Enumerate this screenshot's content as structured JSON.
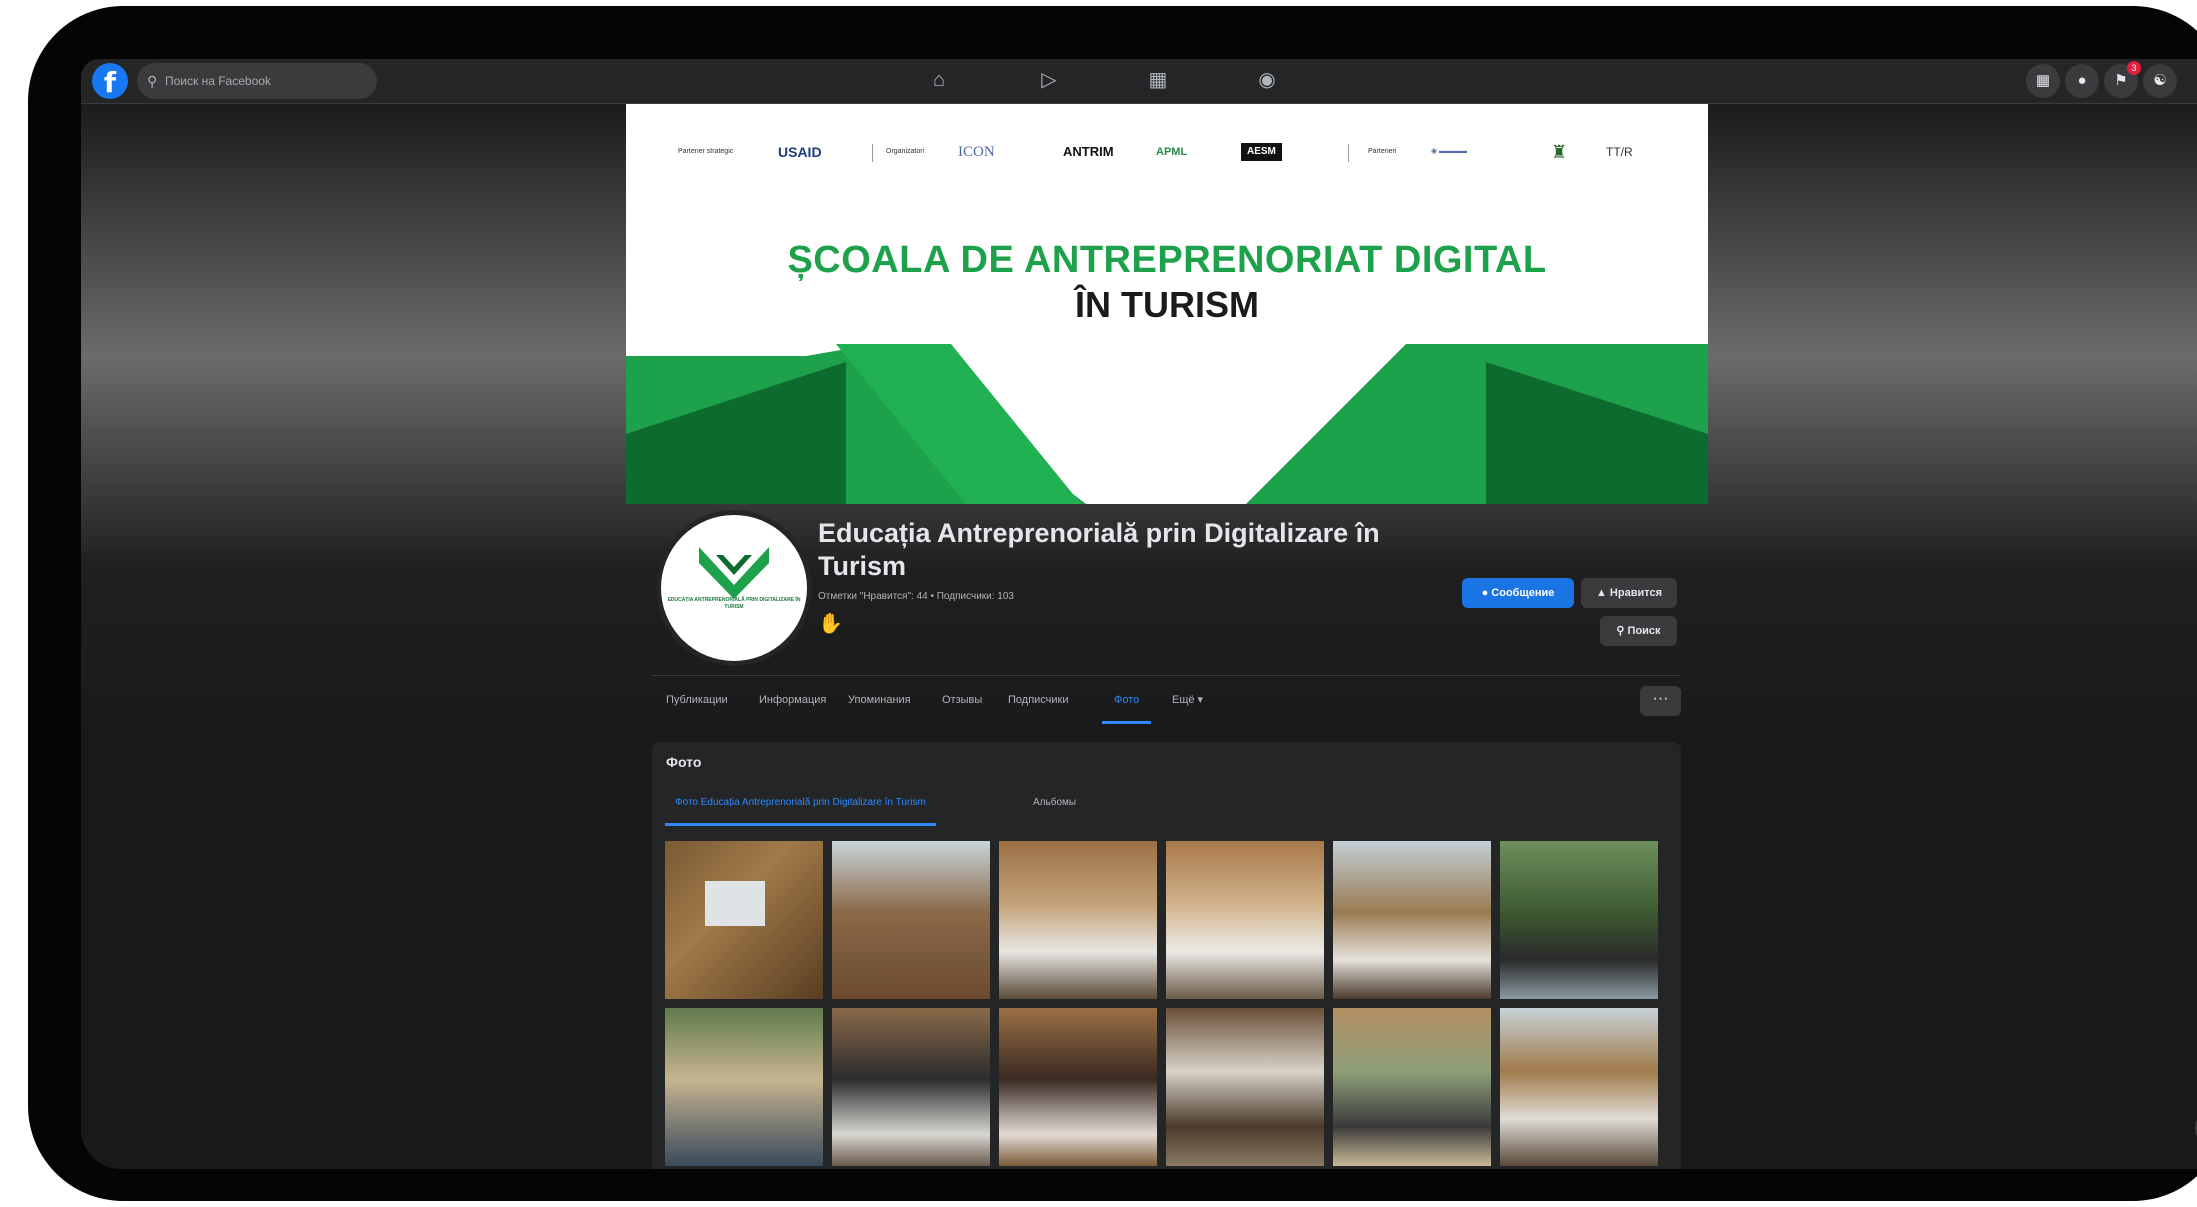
{
  "topbar": {
    "logo": "f",
    "search_placeholder": "Поиск на Facebook",
    "nav_icons": [
      "home-icon",
      "watch-icon",
      "marketplace-icon",
      "gaming-icon"
    ],
    "right_icons": [
      "menu-grid-icon",
      "messenger-icon",
      "bell-icon",
      "account-icon"
    ],
    "notification_count": "3"
  },
  "cover": {
    "sponsors": {
      "strategic_label": "Partener strategic",
      "usaid": "USAID",
      "organizers_label": "Organizatori",
      "icon": "ICON",
      "antrim": "ANTRIM",
      "apl": "APML",
      "aesm": "AESM",
      "partners_label": "Parteneri",
      "ttr": "TT/R"
    },
    "title_line1": "ȘCOALA DE ANTREPRENORIAT DIGITAL",
    "title_line2": "ÎN TURISM",
    "colors": {
      "green": "#1da24b",
      "dark_green": "#0e6b30"
    }
  },
  "profile": {
    "logo_text": "EDUCAȚIA ANTREPRENORIALĂ PRIN DIGITALIZARE ÎN TURISM",
    "name": "Educația Antreprenorială prin Digitalizare în Turism",
    "stats": "Отметки \"Нравится\": 44 • Подписчики: 103",
    "handshake_icon": "handshake-icon"
  },
  "actions": {
    "message": "Сообщение",
    "like": "Нравится",
    "search": "Поиск"
  },
  "tabs": [
    {
      "label": "Публикации"
    },
    {
      "label": "Информация"
    },
    {
      "label": "Упоминания"
    },
    {
      "label": "Отзывы"
    },
    {
      "label": "Подписчики"
    },
    {
      "label": "Фото"
    },
    {
      "label": "Ещё ▾"
    }
  ],
  "more_label": "···",
  "photos": {
    "title": "Фото",
    "sub_tabs": [
      {
        "label": "Фото Educația Antreprenorială prin Digitalizare în Turism"
      },
      {
        "label": "Альбомы"
      }
    ]
  },
  "colors": {
    "accent": "#2d88ff",
    "surface": "#242526",
    "background": "#18191a"
  }
}
